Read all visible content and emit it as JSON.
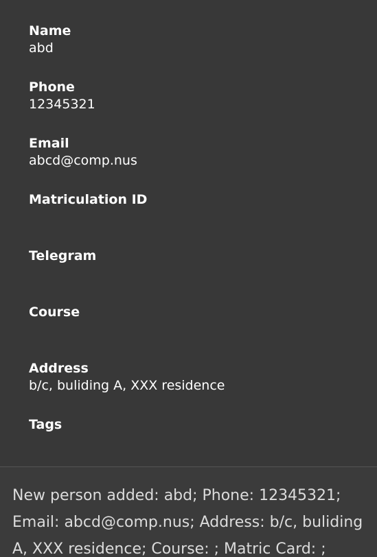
{
  "details": {
    "fields": [
      {
        "label": "Name",
        "value": "abd"
      },
      {
        "label": "Phone",
        "value": "12345321"
      },
      {
        "label": "Email",
        "value": "abcd@comp.nus"
      },
      {
        "label": "Matriculation ID",
        "value": ""
      },
      {
        "label": "Telegram",
        "value": ""
      },
      {
        "label": "Course",
        "value": ""
      },
      {
        "label": "Address",
        "value": "b/c, buliding A, XXX residence"
      },
      {
        "label": "Tags",
        "value": ""
      }
    ]
  },
  "result": {
    "message": "New person added: abd; Phone: 12345321; Email: abcd@comp.nus; Address: b/c, buliding A, XXX residence; Course: ; Matric Card: ;"
  },
  "colors": {
    "background": "#383838",
    "text": "#ffffff",
    "result_text": "#dcdcdc"
  }
}
